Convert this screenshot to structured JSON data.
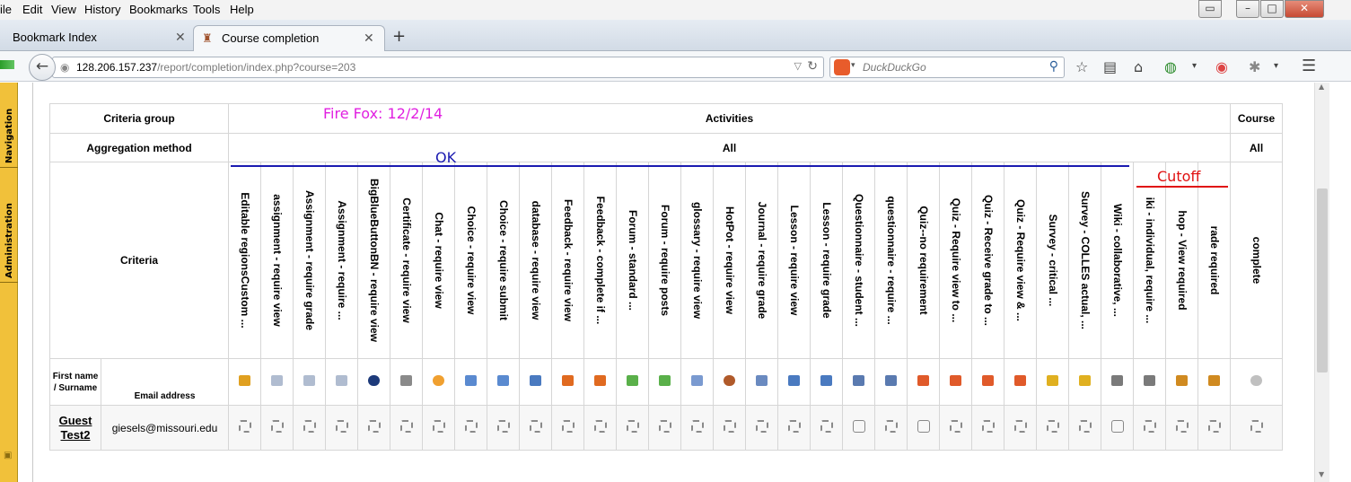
{
  "menu": [
    "ile",
    "Edit",
    "View",
    "History",
    "Bookmarks",
    "Tools",
    "Help"
  ],
  "tabs": [
    {
      "label": "Bookmark Index"
    },
    {
      "label": "Course completion"
    }
  ],
  "url": {
    "host": "128.206.157.237",
    "path": "/report/completion/index.php?course=203"
  },
  "search": {
    "placeholder": "DuckDuckGo"
  },
  "dock": {
    "navigation": "Navigation",
    "administration": "Administration"
  },
  "table": {
    "criteria_group_label": "Criteria group",
    "aggregation_label": "Aggregation method",
    "criteria_label": "Criteria",
    "activities_label": "Activities",
    "course_label": "Course",
    "all_activities": "All",
    "all_course": "All",
    "firstname_label": "First name",
    "surname_label": "Surname",
    "email_label": "Email address",
    "criteria": [
      "Editable regionsCustom ...",
      "assignment - require view",
      "Assignment - require grade",
      "Assignment - require ...",
      "BigBlueButtonBN - require view",
      "Certificate - require view",
      "Chat - require view",
      "Choice - require view",
      "Choice - require submit",
      "database - require view",
      "Feedback - require view",
      "Feedback - complete if ...",
      "Forum - standard ...",
      "Forum - require posts",
      "glossary - require view",
      "HotPot - require view",
      "Journal - require grade",
      "Lesson - require view",
      "Lesson - require grade",
      "Questionnaire - student ...",
      "questionnaire - require ...",
      "Quiz--no requirement",
      "Quiz - Require view to ...",
      "Quiz - Receive grade to ...",
      "Quiz - Require view & ...",
      "Survey - critical ...",
      "Survey - COLLES actual, ...",
      "Wiki - collaborative, ...",
      "iki - individual, require ...",
      "hop - View required",
      "rade required"
    ],
    "course_criteria": "complete",
    "icons": [
      "tag-icon",
      "assign-icon",
      "assign-icon",
      "assign-icon",
      "bigbluebutton-icon",
      "certificate-icon",
      "chat-icon",
      "choice-icon",
      "choice-icon",
      "database-icon",
      "feedback-icon",
      "feedback-icon",
      "forum-icon",
      "forum-icon",
      "glossary-icon",
      "hotpot-icon",
      "journal-icon",
      "lesson-icon",
      "lesson-icon",
      "questionnaire-icon",
      "questionnaire-icon",
      "quiz-icon",
      "quiz-icon",
      "quiz-icon",
      "quiz-icon",
      "survey-icon",
      "survey-icon",
      "wiki-icon",
      "wiki-icon",
      "workshop-icon",
      "workshop-icon"
    ],
    "user": {
      "first": "Guest",
      "last": "Test2",
      "email": "giesels@missouri.edu"
    },
    "status": [
      "dashed",
      "dashed",
      "dashed",
      "dashed",
      "dashed",
      "dashed",
      "dashed",
      "dashed",
      "dashed",
      "dashed",
      "dashed",
      "dashed",
      "dashed",
      "dashed",
      "dashed",
      "dashed",
      "dashed",
      "dashed",
      "dashed",
      "solid",
      "dashed",
      "solid",
      "dashed",
      "dashed",
      "dashed",
      "dashed",
      "dashed",
      "solid",
      "dashed",
      "dashed",
      "dashed"
    ],
    "course_status": "dashed"
  },
  "annotations": {
    "firefox": "Fire Fox: 12/2/14",
    "ok": "OK",
    "cutoff": "Cutoff",
    "firefox_color": "#e020e0",
    "ok_color": "#1a1ab0",
    "cutoff_color": "#e01010"
  }
}
